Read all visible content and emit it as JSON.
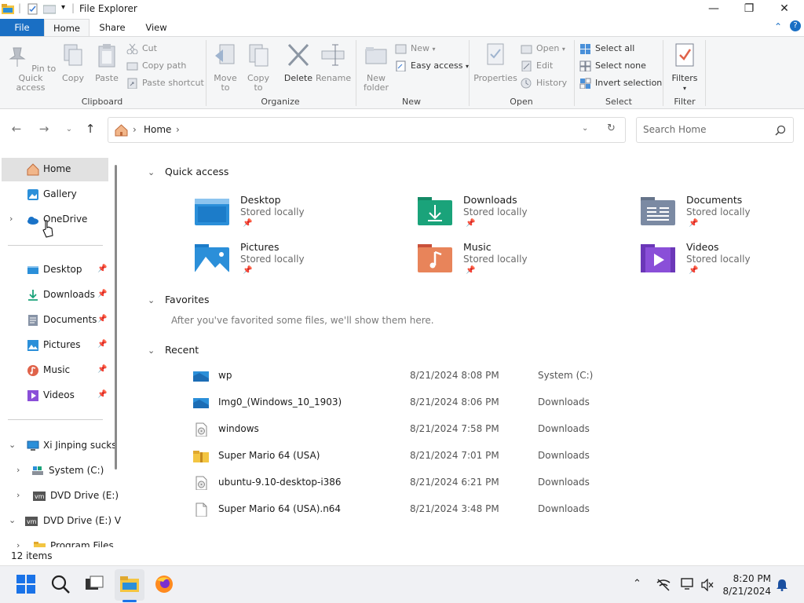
{
  "window": {
    "title": "File Explorer"
  },
  "ribbon_tabs": {
    "file": "File",
    "home": "Home",
    "share": "Share",
    "view": "View"
  },
  "ribbon": {
    "clipboard": {
      "label": "Clipboard",
      "pin": "Pin to Quick access",
      "copy": "Copy",
      "paste": "Paste",
      "cut": "Cut",
      "copy_path": "Copy path",
      "paste_shortcut": "Paste shortcut"
    },
    "organize": {
      "label": "Organize",
      "move_to": "Move to",
      "copy_to": "Copy to",
      "delete": "Delete",
      "rename": "Rename"
    },
    "new": {
      "label": "New",
      "new_folder": "New folder",
      "new_item": "New",
      "easy_access": "Easy access"
    },
    "open": {
      "label": "Open",
      "properties": "Properties",
      "open": "Open",
      "edit": "Edit",
      "history": "History"
    },
    "select": {
      "label": "Select",
      "select_all": "Select all",
      "select_none": "Select none",
      "invert": "Invert selection"
    },
    "filter": {
      "label": "Filter",
      "filters": "Filters"
    }
  },
  "address": {
    "crumb": "Home"
  },
  "search": {
    "placeholder": "Search Home"
  },
  "sidebar": {
    "top": [
      {
        "label": "Home",
        "icon": "home-icon"
      },
      {
        "label": "Gallery",
        "icon": "gallery-icon"
      },
      {
        "label": "OneDrive",
        "icon": "onedrive-icon"
      }
    ],
    "pinned": [
      {
        "label": "Desktop",
        "icon": "desktop-icon"
      },
      {
        "label": "Downloads",
        "icon": "downloads-icon"
      },
      {
        "label": "Documents",
        "icon": "documents-icon"
      },
      {
        "label": "Pictures",
        "icon": "pictures-icon"
      },
      {
        "label": "Music",
        "icon": "music-icon"
      },
      {
        "label": "Videos",
        "icon": "videos-icon"
      }
    ],
    "tree": [
      {
        "label": "Xi Jinping sucks",
        "icon": "pc-icon"
      },
      {
        "label": "System (C:)",
        "icon": "drive-icon"
      },
      {
        "label": "DVD Drive (E:)",
        "icon": "dvd-icon"
      },
      {
        "label": "DVD Drive (E:) V",
        "icon": "dvd-icon"
      },
      {
        "label": "Program Files",
        "icon": "folder-icon"
      }
    ]
  },
  "main": {
    "quick_access": {
      "heading": "Quick access",
      "items": [
        {
          "name": "Desktop",
          "sub": "Stored locally",
          "color": "#2b8fd9"
        },
        {
          "name": "Downloads",
          "sub": "Stored locally",
          "color": "#1aa37a"
        },
        {
          "name": "Documents",
          "sub": "Stored locally",
          "color": "#7b8aa3"
        },
        {
          "name": "Pictures",
          "sub": "Stored locally",
          "color": "#2b8fd9"
        },
        {
          "name": "Music",
          "sub": "Stored locally",
          "color": "#e0634a"
        },
        {
          "name": "Videos",
          "sub": "Stored locally",
          "color": "#8a4fd8"
        }
      ]
    },
    "favorites": {
      "heading": "Favorites",
      "empty": "After you've favorited some files, we'll show them here."
    },
    "recent": {
      "heading": "Recent",
      "items": [
        {
          "name": "wp",
          "date": "8/21/2024 8:08 PM",
          "location": "System (C:)",
          "icon": "image-file-icon"
        },
        {
          "name": "Img0_(Windows_10_1903)",
          "date": "8/21/2024 8:06 PM",
          "location": "Downloads",
          "icon": "image-file-icon"
        },
        {
          "name": "windows",
          "date": "8/21/2024 7:58 PM",
          "location": "Downloads",
          "icon": "disc-image-icon"
        },
        {
          "name": "Super Mario 64 (USA)",
          "date": "8/21/2024 7:01 PM",
          "location": "Downloads",
          "icon": "zip-folder-icon"
        },
        {
          "name": "ubuntu-9.10-desktop-i386",
          "date": "8/21/2024 6:21 PM",
          "location": "Downloads",
          "icon": "disc-image-icon"
        },
        {
          "name": "Super Mario 64 (USA).n64",
          "date": "8/21/2024 3:48 PM",
          "location": "Downloads",
          "icon": "file-icon"
        }
      ]
    }
  },
  "status": {
    "items": "12 items"
  },
  "taskbar": {
    "time": "8:20 PM",
    "date": "8/21/2024"
  },
  "colors": {
    "accent": "#1a6fc4",
    "selected": "#e1e1e1"
  }
}
